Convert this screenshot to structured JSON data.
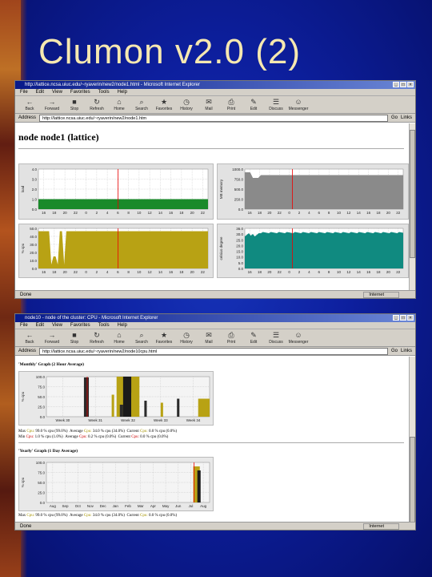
{
  "slide": {
    "title": "Clumon v2.0 (2)"
  },
  "window1": {
    "title": "http://lattice.ncsa.uiuc.edu/~ryaverin/new2/node1.html - Microsoft Internet Explorer",
    "menu": [
      "File",
      "Edit",
      "View",
      "Favorites",
      "Tools",
      "Help"
    ],
    "toolbar": [
      "Back",
      "Forward",
      "Stop",
      "Refresh",
      "Home",
      "Search",
      "Favorites",
      "History",
      "Mail",
      "Print",
      "Edit",
      "Discuss",
      "Messenger"
    ],
    "address_label": "Address",
    "address": "http://lattice.ncsa.uiuc.edu/~ryaverin/new2/node1.htm",
    "go": "Go",
    "links": "Links",
    "page_heading": "node node1 (lattice)",
    "status": "Done",
    "zone": "Internet",
    "charts": {
      "load": {
        "ylabel": "load",
        "yticks": [
          "4.0",
          "3.0",
          "2.0",
          "1.0",
          "0.0"
        ],
        "xticks": [
          "16",
          "18",
          "20",
          "22",
          "0",
          "2",
          "4",
          "6",
          "8",
          "10",
          "12",
          "14",
          "16",
          "18",
          "20",
          "22"
        ]
      },
      "memory": {
        "ylabel": "MB memory",
        "yticks": [
          "1000.0",
          "750.0",
          "500.0",
          "250.0",
          "0.0"
        ],
        "xticks": [
          "16",
          "18",
          "20",
          "22",
          "0",
          "2",
          "4",
          "6",
          "8",
          "10",
          "12",
          "14",
          "16",
          "18",
          "20",
          "22"
        ]
      },
      "cpu": {
        "ylabel": "% cpu",
        "yticks": [
          "50.0",
          "40.0",
          "30.0",
          "20.0",
          "10.0",
          "0.0"
        ],
        "xticks": [
          "16",
          "18",
          "20",
          "22",
          "0",
          "2",
          "4",
          "6",
          "8",
          "10",
          "12",
          "14",
          "16",
          "18",
          "20",
          "22"
        ]
      },
      "temp": {
        "ylabel": "celsius degree",
        "yticks": [
          "36.0",
          "30.0",
          "25.0",
          "20.0",
          "15.0",
          "10.0",
          "5.0",
          "0.0"
        ],
        "xticks": [
          "16",
          "18",
          "20",
          "22",
          "0",
          "2",
          "4",
          "6",
          "8",
          "10",
          "12",
          "14",
          "16",
          "18",
          "20",
          "22"
        ]
      }
    }
  },
  "window2": {
    "title": "node10 - node of the cluster: CPU - Microsoft Internet Explorer",
    "menu": [
      "File",
      "Edit",
      "View",
      "Favorites",
      "Tools",
      "Help"
    ],
    "toolbar": [
      "Back",
      "Forward",
      "Stop",
      "Refresh",
      "Home",
      "Search",
      "Favorites",
      "History",
      "Mail",
      "Print",
      "Edit",
      "Discuss",
      "Messenger"
    ],
    "address_label": "Address",
    "address": "http://lattice.ncsa.uiuc.edu/~ryaverin/new2/node10cpu.html",
    "go": "Go",
    "links": "Links",
    "status": "Done",
    "zone": "Internet",
    "monthly": {
      "title": "'Monthly' Graph (2 Hour Average)",
      "ylabel": "% cpu",
      "yticks": [
        "100.0",
        "75.0",
        "50.0",
        "25.0",
        "0.0"
      ],
      "xticks": [
        "Week 30",
        "Week 31",
        "Week 32",
        "Week 33",
        "Week 34"
      ],
      "stat1": {
        "max_label": "Max",
        "cpu_label": "Cpu:",
        "max": "99.0 % cpu (99.0%)",
        "avg_label": "Average",
        "avg": "34.0 % cpu (34.0%)",
        "cur_label": "Current",
        "cur": "0.0 % cpu (0.0%)"
      },
      "stat2": {
        "min_label": "Min",
        "cpu_label": "Cpu:",
        "min": "1.0 % cpu (1.0%)",
        "avg_label": "Average",
        "avg": "0.2 % cpu (0.0%)",
        "cur_label": "Current",
        "cur": "0.0 % cpu (0.0%)"
      }
    },
    "yearly": {
      "title": "'Yearly' Graph (1 Day Average)",
      "ylabel": "% cpu",
      "yticks": [
        "100.0",
        "75.0",
        "50.0",
        "25.0",
        "0.0"
      ],
      "xticks": [
        "Aug",
        "Sep",
        "Oct",
        "Nov",
        "Dec",
        "Jan",
        "Feb",
        "Mar",
        "Apr",
        "May",
        "Jun",
        "Jul",
        "Aug"
      ],
      "stat1": {
        "max_label": "Max",
        "cpu_label": "Cpu:",
        "max": "99.0 % cpu (99.0%)",
        "avg_label": "Average",
        "avg": "34.0 % cpu (34.0%)",
        "cur_label": "Current",
        "cur": "0.0 % cpu (0.0%)"
      }
    }
  }
}
